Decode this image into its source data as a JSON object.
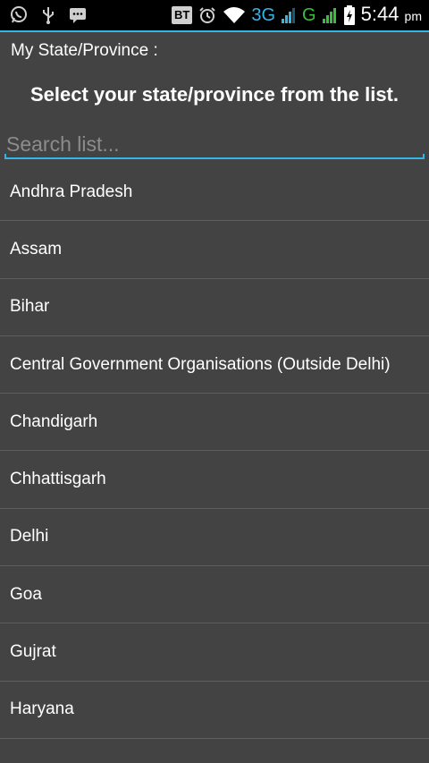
{
  "status_bar": {
    "left_icons": [
      "whatsapp-icon",
      "usb-icon",
      "message-icon"
    ],
    "bt_label": "BT",
    "network_3g": "3G",
    "network_g": "G",
    "time": "5:44",
    "ampm": "pm",
    "accent": "#33b5e5"
  },
  "screen": {
    "label": "My State/Province :",
    "heading": "Select your state/province from the list."
  },
  "search": {
    "placeholder": "Search list..."
  },
  "states": [
    "Andhra Pradesh",
    "Assam",
    "Bihar",
    "Central Government Organisations (Outside Delhi)",
    "Chandigarh",
    "Chhattisgarh",
    "Delhi",
    "Goa",
    "Gujrat",
    "Haryana"
  ]
}
